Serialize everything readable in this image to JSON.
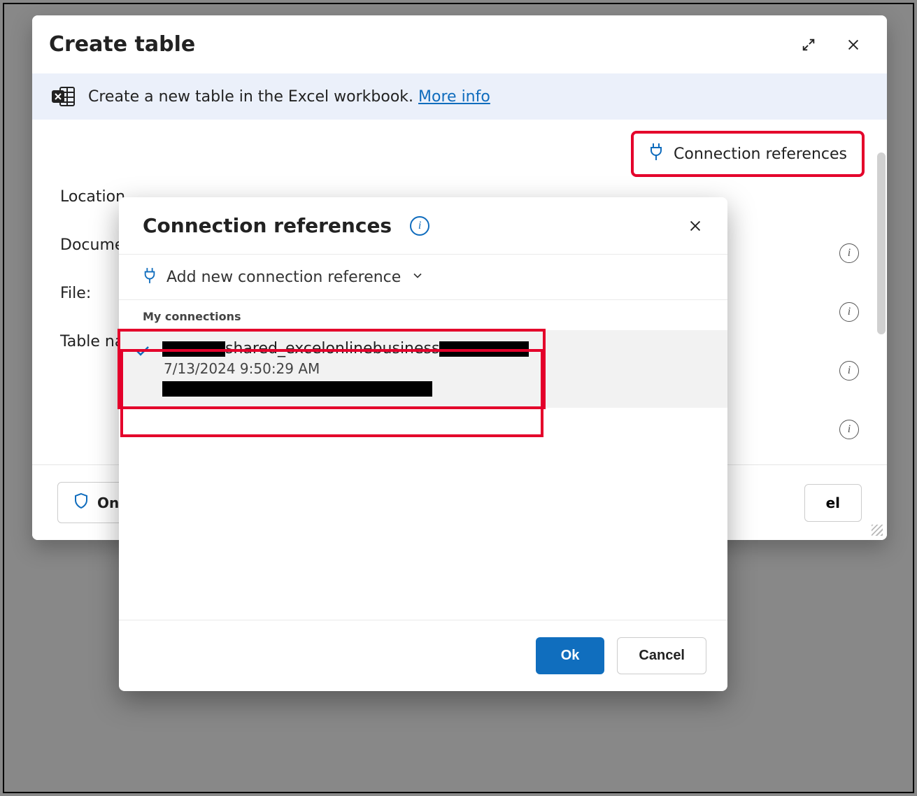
{
  "main": {
    "title": "Create table",
    "banner_text": "Create a new table in the Excel workbook.",
    "banner_link": "More info",
    "conn_ref_button": "Connection references",
    "labels": {
      "location": "Location",
      "document": "Docume",
      "file": "File:",
      "table": "Table na"
    },
    "owner_button": "On",
    "cancel_partial": "el"
  },
  "sub": {
    "title": "Connection references",
    "add_label": "Add new connection reference",
    "section_label": "My connections",
    "item": {
      "name_middle": "shared_excelonlinebusiness",
      "timestamp": "7/13/2024 9:50:29 AM"
    },
    "ok": "Ok",
    "cancel": "Cancel"
  }
}
